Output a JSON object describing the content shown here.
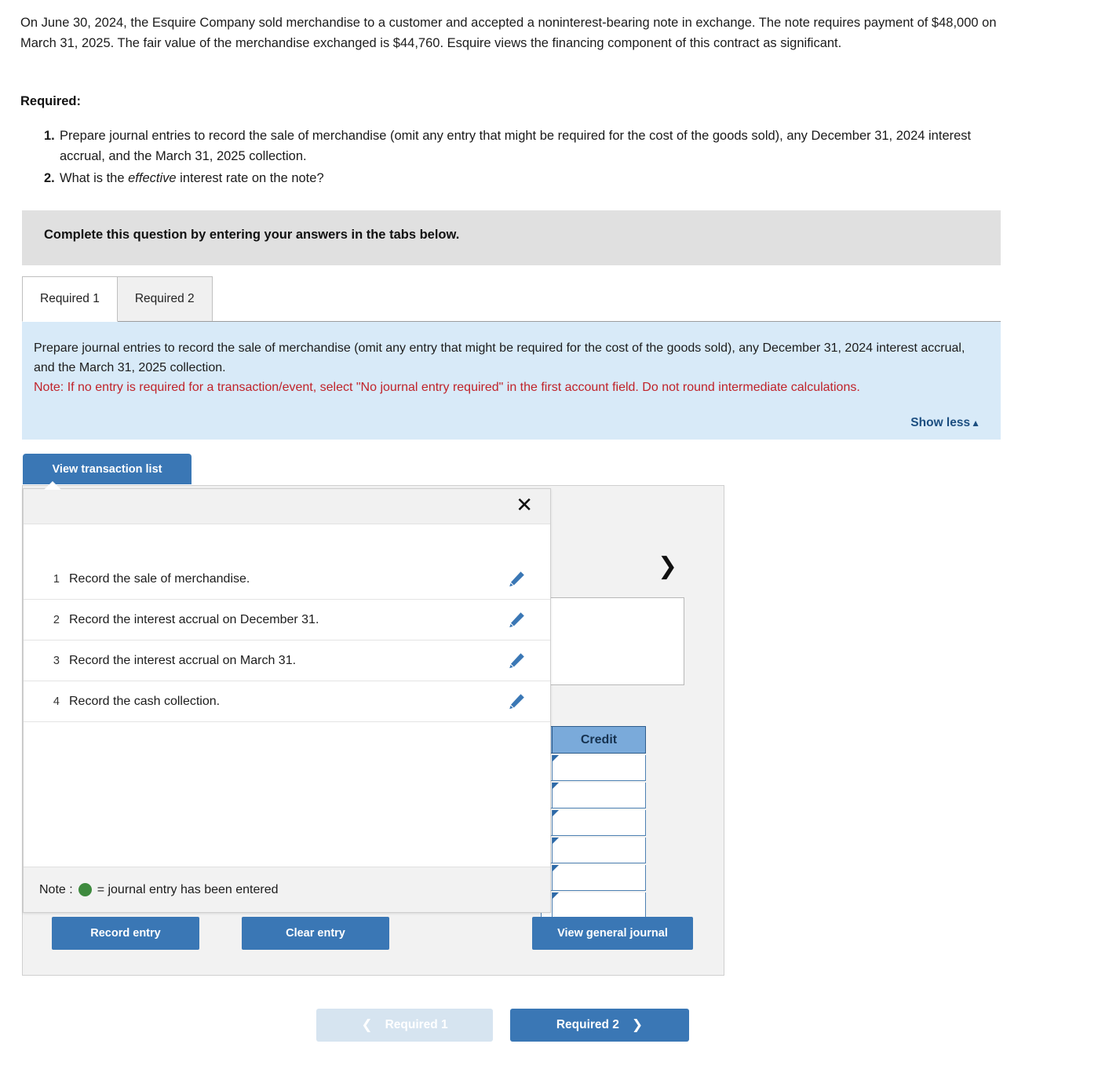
{
  "problem": {
    "text": "On June 30, 2024, the Esquire Company sold merchandise to a customer and accepted a noninterest-bearing note in exchange. The note requires payment of $48,000 on March 31, 2025. The fair value of the merchandise exchanged is $44,760. Esquire views the financing component of this contract as significant.",
    "required_heading": "Required:",
    "items": [
      {
        "num": "1.",
        "text": "Prepare journal entries to record the sale of merchandise (omit any entry that might be required for the cost of the goods sold), any December 31, 2024 interest accrual, and the March 31, 2025 collection."
      },
      {
        "num": "2.",
        "pre": "What is the ",
        "italic": "effective",
        "post": " interest rate on the note?"
      }
    ]
  },
  "banner": {
    "text": "Complete this question by entering your answers in the tabs below."
  },
  "tabs": [
    {
      "label": "Required 1",
      "active": true
    },
    {
      "label": "Required 2",
      "active": false
    }
  ],
  "instructions": {
    "line1": "Prepare journal entries to record the sale of merchandise (omit any entry that might be required for the cost of the goods sold), any December 31, 2024 interest accrual, and the March 31, 2025 collection.",
    "note": "Note: If no entry is required for a transaction/event, select \"No journal entry required\" in the first account field. Do not round intermediate calculations.",
    "show_less_label": "Show less",
    "show_less_caret": "▲"
  },
  "worksheet": {
    "view_transaction_list_label": "View transaction list",
    "next_chevron": "❯",
    "credit_header": "Credit",
    "credit_rows": [
      "",
      "",
      "",
      "",
      "",
      ""
    ],
    "view_general_journal_label": "View general journal"
  },
  "transaction_popup": {
    "close_label": "✕",
    "rows": [
      {
        "num": "1",
        "label": "Record the sale of merchandise."
      },
      {
        "num": "2",
        "label": "Record the interest accrual on December 31."
      },
      {
        "num": "3",
        "label": "Record the interest accrual on March 31."
      },
      {
        "num": "4",
        "label": "Record the cash collection."
      }
    ],
    "note_prefix": "Note :",
    "note_suffix": "= journal entry has been entered",
    "note_dot_color": "#3e8a3e"
  },
  "actions": {
    "record_entry_label": "Record entry",
    "clear_entry_label": "Clear entry"
  },
  "bottom_nav": {
    "prev_label": "Required 1",
    "prev_chevron": "❮",
    "next_label": "Required 2",
    "next_chevron": "❯"
  },
  "colors": {
    "primary_blue": "#3a77b5",
    "instruction_bg": "#d8eaf8",
    "banner_bg": "#e0e0e0",
    "note_red": "#c0232a",
    "credit_header_blue": "#7aaada",
    "link_blue": "#1c4e80"
  }
}
